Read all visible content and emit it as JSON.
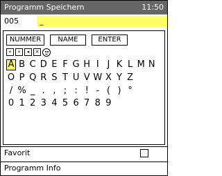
{
  "titlebar": {
    "title": "Programm Speichern",
    "time": "11:50"
  },
  "input": {
    "number": "005",
    "value": "_"
  },
  "modes": [
    "NUMMER",
    "NAME",
    "ENTER"
  ],
  "icons": [
    "prev-icon",
    "next-icon",
    "backspace-icon",
    "delete-icon",
    "smiley-icon"
  ],
  "rows": [
    [
      "A",
      "B",
      "C",
      "D",
      "E",
      "F",
      "G",
      "H",
      "I",
      "J",
      "K",
      "L",
      "M",
      "N"
    ],
    [
      "O",
      "P",
      "Q",
      "R",
      "S",
      "T",
      "U",
      "V",
      "W",
      "X",
      "Y",
      "Z"
    ],
    [
      "/",
      "%",
      "_",
      ".",
      ",",
      ";",
      ":",
      "!",
      "-",
      "(",
      ")",
      "°"
    ],
    [
      "0",
      "1",
      "2",
      "3",
      "4",
      "5",
      "6",
      "7",
      "8",
      "9"
    ]
  ],
  "selected": "A",
  "options": {
    "favorit": "Favorit",
    "info": "Programm Info"
  },
  "favorit_checked": false,
  "colors": {
    "titlebar": "#666666",
    "highlight": "#ffff66"
  }
}
